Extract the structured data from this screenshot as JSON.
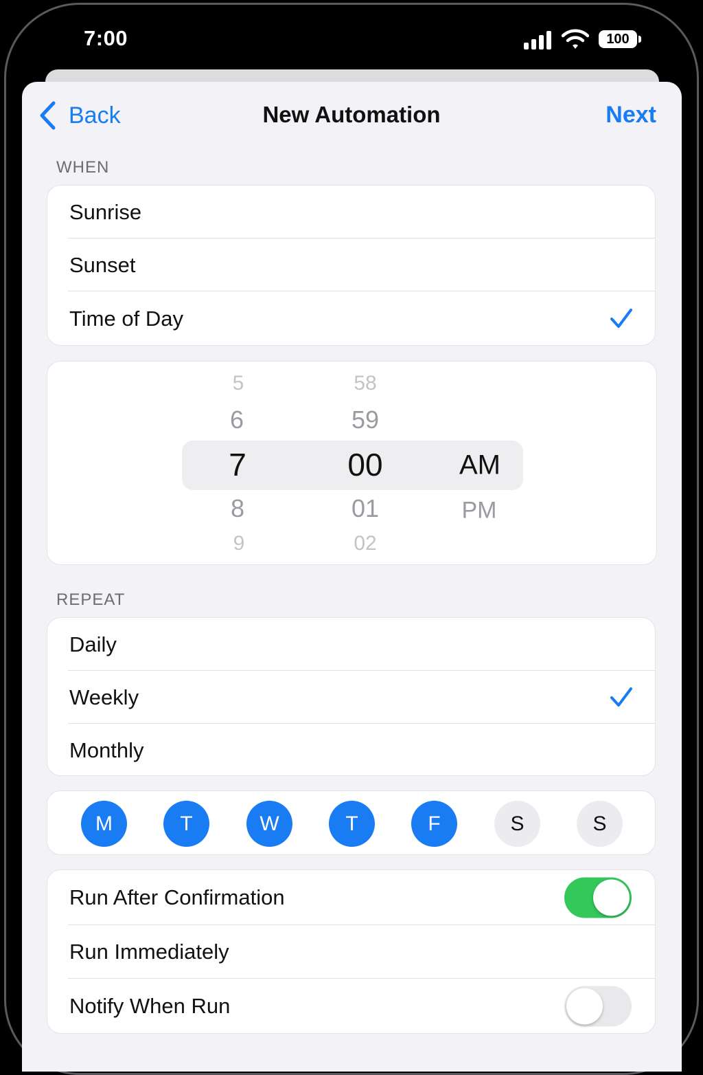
{
  "status_bar": {
    "time": "7:00",
    "battery": "100"
  },
  "nav": {
    "back_label": "Back",
    "title": "New Automation",
    "next_label": "Next"
  },
  "when": {
    "section_label": "WHEN",
    "options": [
      {
        "label": "Sunrise",
        "selected": false
      },
      {
        "label": "Sunset",
        "selected": false
      },
      {
        "label": "Time of Day",
        "selected": true
      }
    ]
  },
  "time_picker": {
    "hours": [
      "5",
      "6",
      "7",
      "8",
      "9"
    ],
    "minutes": [
      "58",
      "59",
      "00",
      "01",
      "02"
    ],
    "periods": [
      "AM",
      "PM"
    ],
    "selected": {
      "hour": "7",
      "minute": "00",
      "period": "AM"
    }
  },
  "repeat": {
    "section_label": "REPEAT",
    "options": [
      {
        "label": "Daily",
        "selected": false
      },
      {
        "label": "Weekly",
        "selected": true
      },
      {
        "label": "Monthly",
        "selected": false
      }
    ],
    "days": [
      {
        "label": "M",
        "active": true
      },
      {
        "label": "T",
        "active": true
      },
      {
        "label": "W",
        "active": true
      },
      {
        "label": "T",
        "active": true
      },
      {
        "label": "F",
        "active": true
      },
      {
        "label": "S",
        "active": false
      },
      {
        "label": "S",
        "active": false
      }
    ]
  },
  "settings": [
    {
      "label": "Run After Confirmation",
      "toggle": true,
      "value": true
    },
    {
      "label": "Run Immediately",
      "toggle": false
    },
    {
      "label": "Notify When Run",
      "toggle": true,
      "value": false
    }
  ],
  "colors": {
    "accent": "#1a7cf2",
    "toggle_on": "#34c759",
    "background": "#f2f2f7"
  }
}
